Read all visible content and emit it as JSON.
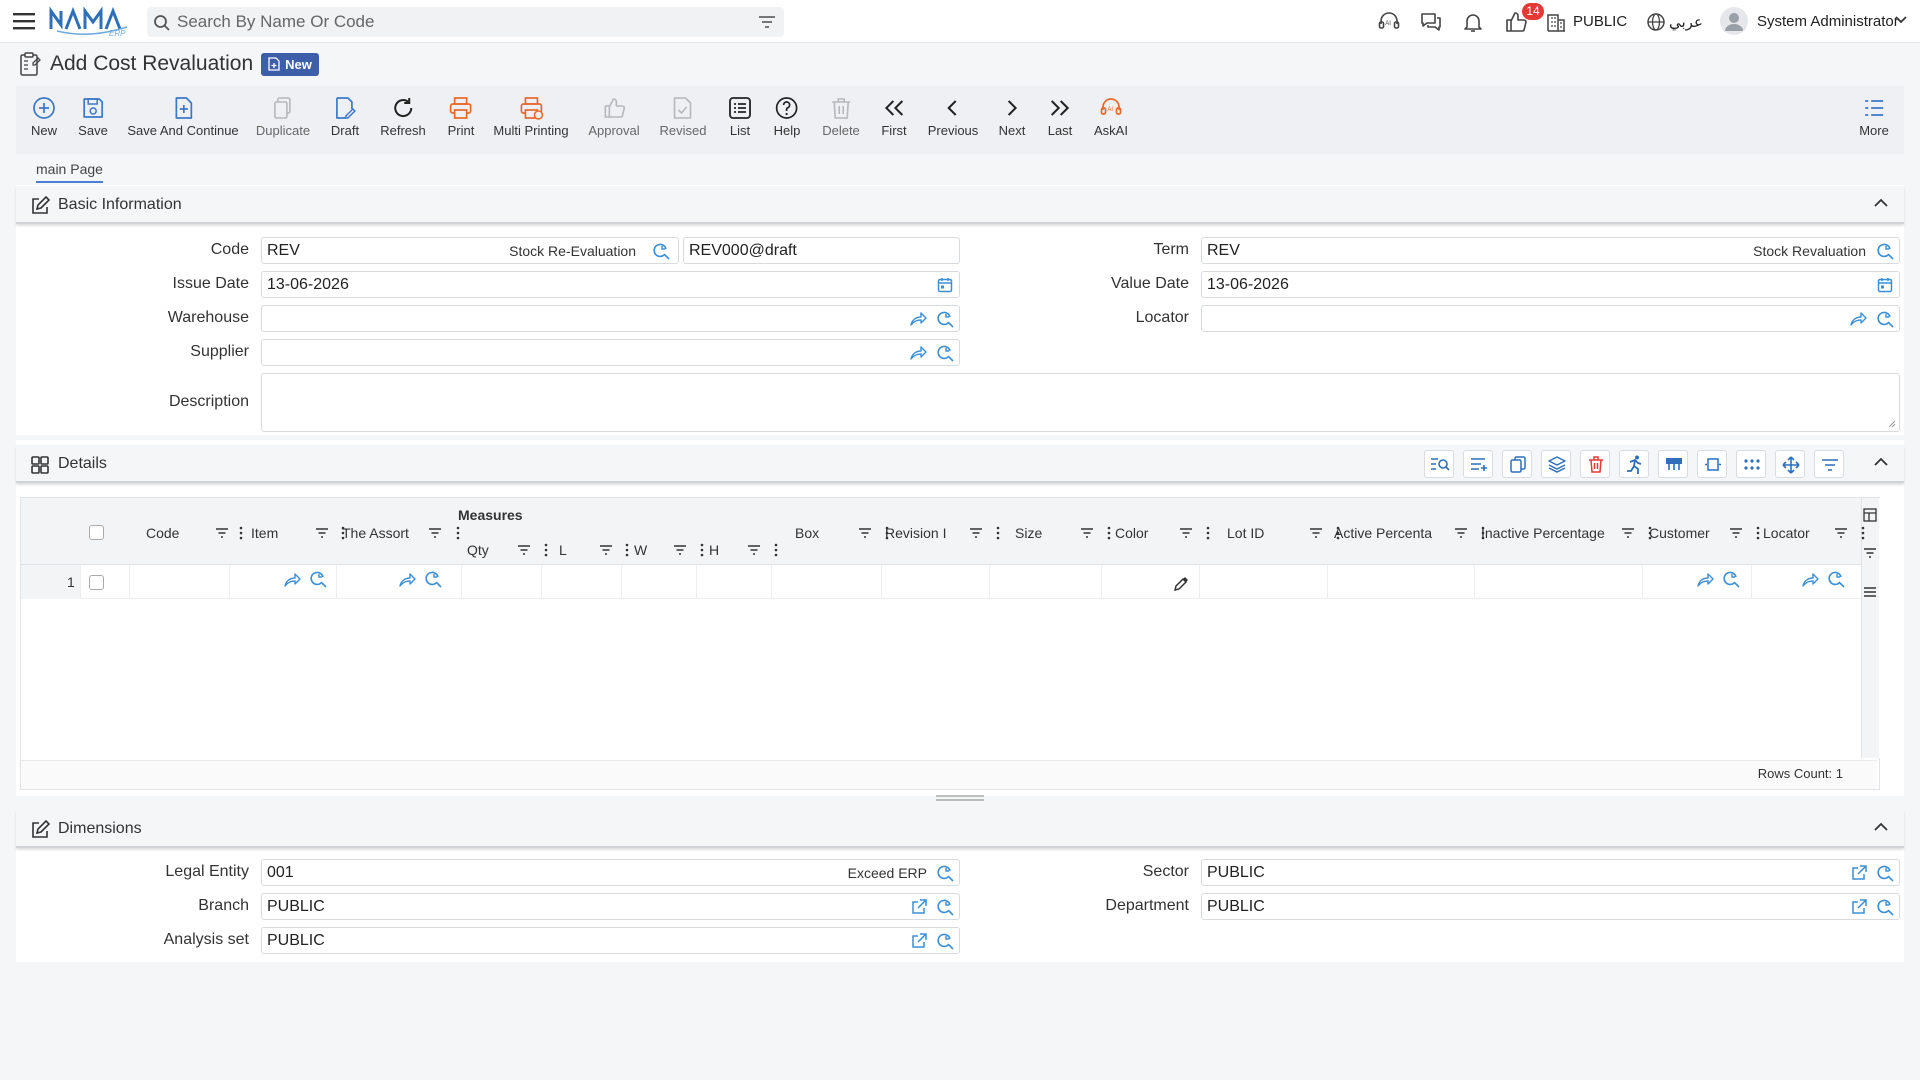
{
  "topbar": {
    "search_placeholder": "Search By Name Or Code",
    "notification_count": "14",
    "branch_label": "PUBLIC",
    "language_label": "عربي",
    "user_name": "System Administrator"
  },
  "page": {
    "title": "Add Cost Revaluation",
    "status_badge": "New"
  },
  "toolbar": {
    "buttons": [
      {
        "label": "New",
        "icon": "plus-circle-icon",
        "enabled": true
      },
      {
        "label": "Save",
        "icon": "save-icon",
        "enabled": true
      },
      {
        "label": "Save And Continue",
        "icon": "save-continue-icon",
        "enabled": true
      },
      {
        "label": "Duplicate",
        "icon": "duplicate-icon",
        "enabled": false
      },
      {
        "label": "Draft",
        "icon": "draft-icon",
        "enabled": true
      },
      {
        "label": "Refresh",
        "icon": "refresh-icon",
        "enabled": true
      },
      {
        "label": "Print",
        "icon": "print-icon",
        "enabled": true
      },
      {
        "label": "Multi Printing",
        "icon": "multi-print-icon",
        "enabled": true
      },
      {
        "label": "Approval",
        "icon": "thumbs-up-icon",
        "enabled": false
      },
      {
        "label": "Revised",
        "icon": "revised-icon",
        "enabled": false
      },
      {
        "label": "List",
        "icon": "list-icon",
        "enabled": true
      },
      {
        "label": "Help",
        "icon": "help-icon",
        "enabled": true
      },
      {
        "label": "Delete",
        "icon": "trash-icon",
        "enabled": false
      },
      {
        "label": "First",
        "icon": "double-chevron-left-icon",
        "enabled": true
      },
      {
        "label": "Previous",
        "icon": "chevron-left-icon",
        "enabled": true
      },
      {
        "label": "Next",
        "icon": "chevron-right-icon",
        "enabled": true
      },
      {
        "label": "Last",
        "icon": "double-chevron-right-icon",
        "enabled": true
      },
      {
        "label": "AskAI",
        "icon": "ai-headset-icon",
        "enabled": true
      }
    ],
    "more_label": "More"
  },
  "tabs": {
    "main": "main Page"
  },
  "basic_info": {
    "title": "Basic Information",
    "code_label": "Code",
    "code_value": "REV",
    "code_tag": "Stock Re-Evaluation",
    "code_number": "REV000@draft",
    "term_label": "Term",
    "term_value": "REV",
    "term_tag": "Stock Revaluation",
    "issue_date_label": "Issue Date",
    "issue_date": "13-06-2026",
    "value_date_label": "Value Date",
    "value_date": "13-06-2026",
    "warehouse_label": "Warehouse",
    "warehouse_value": "",
    "locator_label": "Locator",
    "locator_value": "",
    "supplier_label": "Supplier",
    "supplier_value": "",
    "description_label": "Description",
    "description_value": ""
  },
  "details": {
    "title": "Details",
    "columns": [
      "Code",
      "Item",
      "The Assort",
      "Box",
      "Revision I",
      "Size",
      "Color",
      "Lot ID",
      "Active Percenta",
      "Inactive Percentage",
      "Customer",
      "Locator"
    ],
    "measures_group": "Measures",
    "measures_columns": [
      "Qty",
      "L",
      "W",
      "H"
    ],
    "rows": [
      {
        "num": "1"
      }
    ],
    "rows_count_label": "Rows Count: 1"
  },
  "dimensions": {
    "title": "Dimensions",
    "legal_entity_label": "Legal Entity",
    "legal_entity_value": "001",
    "legal_entity_tag": "Exceed ERP",
    "sector_label": "Sector",
    "sector_value": "PUBLIC",
    "branch_label": "Branch",
    "branch_value": "PUBLIC",
    "department_label": "Department",
    "department_value": "PUBLIC",
    "analysis_set_label": "Analysis set",
    "analysis_set_value": "PUBLIC"
  },
  "colors": {
    "accent": "#3d5ea8",
    "orange": "#e8692c",
    "badge_red": "#e53935",
    "toolbar_bg": "#eef0f3"
  }
}
